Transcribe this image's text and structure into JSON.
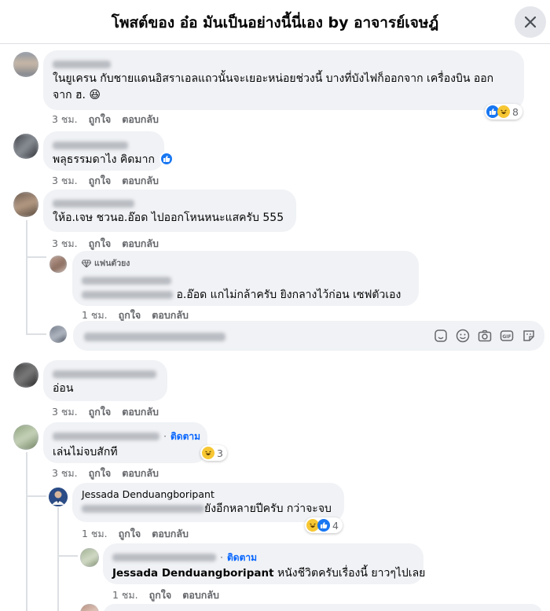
{
  "header": {
    "title": "โพสต์ของ อ๋อ มันเป็นอย่างนี้นี่เอง by อาจารย์เจษฎ์"
  },
  "colors": {
    "link": "#0866ff",
    "meta": "#65676b",
    "bubble": "#f0f2f5"
  },
  "actions": {
    "like": "ถูกใจ",
    "reply": "ตอบกลับ"
  },
  "follow_label": "ติดตาม",
  "comments": [
    {
      "id": "c1",
      "text1": "ในยูเครน กับชายแดนอิสราเอลแถวนั้นจะเยอะหน่อยช่วงนี้ บางที่บังไฟก็ออกจาก เครื่องบิน ออก",
      "text2": "จาก ฮ. 😆",
      "time": "3 ชม.",
      "reaction_count": "8"
    },
    {
      "id": "c2",
      "text": "พลุธรรมดาไง คิดมาก",
      "time": "3 ชม."
    },
    {
      "id": "c3",
      "text": "ให้อ.เจษ ชวนอ.อ๊อด ไปออกโหนหนะแสครับ 555",
      "time": "3 ชม."
    },
    {
      "id": "c3r1",
      "badge": "แฟนตัวยง",
      "text": "อ.อ๊อด แกไม่กล้าครับ ยิงกลางไว้ก่อน เซฟตัวเอง",
      "time": "1 ชม."
    },
    {
      "id": "c4",
      "text": "อ่อน",
      "time": "3 ชม."
    },
    {
      "id": "c5",
      "text": "เล่นไม่จบสักที",
      "time": "3 ชม.",
      "reaction_count": "3"
    },
    {
      "id": "c5r1",
      "name": "Jessada Denduangboripant",
      "text": "ยังอีกหลายปีครับ กว่าจะจบ",
      "time": "1 ชม.",
      "reaction_count": "4"
    },
    {
      "id": "c5r2",
      "mention": "Jessada Denduangboripant",
      "text": " หนังชีวิตครับเรื่องนี้ ยาวๆไปเลย",
      "time": "1 ชม."
    }
  ]
}
